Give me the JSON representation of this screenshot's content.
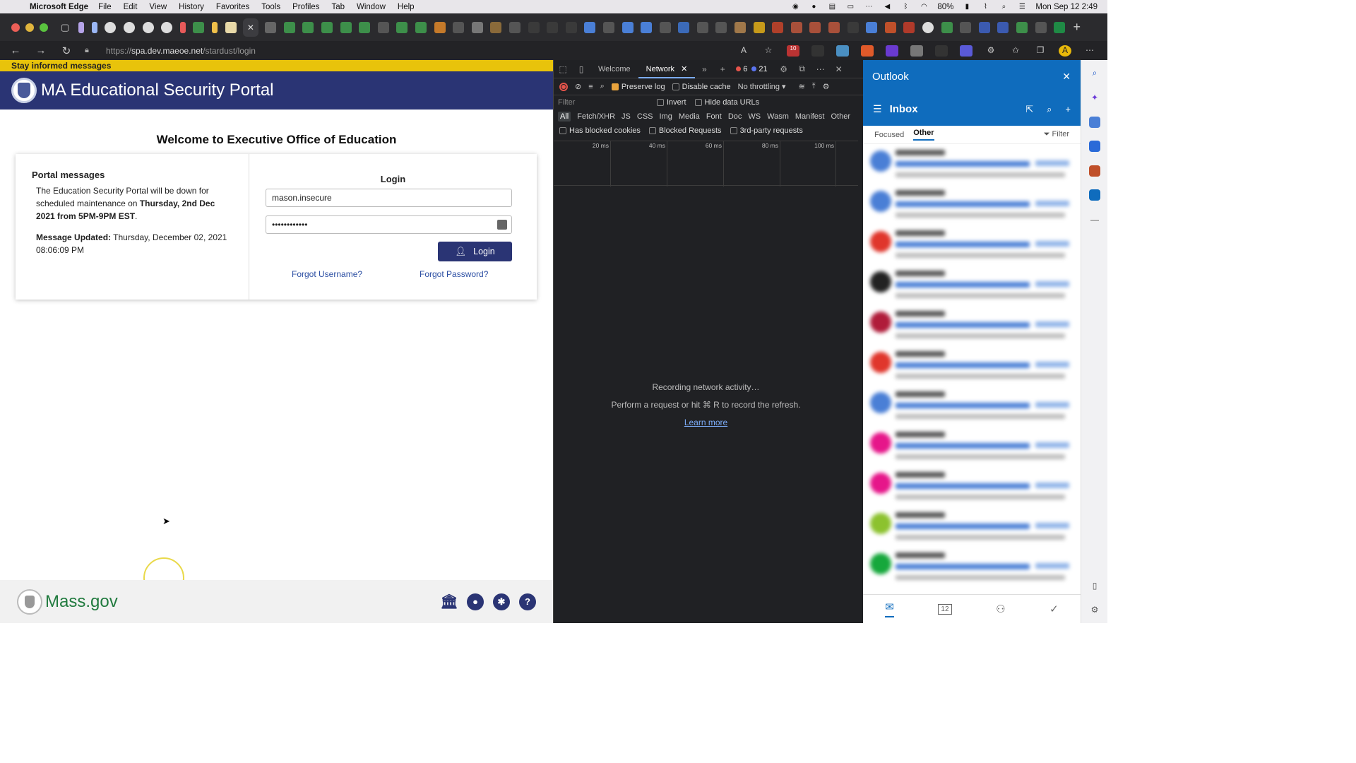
{
  "menubar": {
    "app": "Microsoft Edge",
    "items": [
      "File",
      "Edit",
      "View",
      "History",
      "Favorites",
      "Tools",
      "Profiles",
      "Tab",
      "Window",
      "Help"
    ],
    "battery": "80%",
    "clock": "Mon Sep 12  2:49"
  },
  "browser": {
    "url_prefix": "https://",
    "url_host": "spa.dev.maeoe.net",
    "url_path": "/stardust/login"
  },
  "page": {
    "banner": "Stay informed messages",
    "title": "MA Educational Security Portal",
    "welcome": "Welcome to Executive Office of Education",
    "messages": {
      "heading": "Portal messages",
      "body_start": "The Education Security Portal will be down for scheduled maintenance on ",
      "body_bold": "Thursday, 2nd Dec 2021 from 5PM-9PM EST",
      "body_end": ".",
      "updated_label": "Message Updated:",
      "updated_value": " Thursday, December 02, 2021 08:06:09 PM"
    },
    "login": {
      "heading": "Login",
      "username": "mason.insecure",
      "password_mask": "••••••••••••",
      "button": "Login",
      "forgot_username": "Forgot Username?",
      "forgot_password": "Forgot Password?"
    },
    "footer": {
      "brand": "Mass.gov"
    }
  },
  "devtools": {
    "tabs": [
      "Welcome",
      "Network"
    ],
    "errors": "6",
    "messages": "21",
    "preserve_log": "Preserve log",
    "disable_cache": "Disable cache",
    "throttling": "No throttling",
    "filter_placeholder": "Filter",
    "invert": "Invert",
    "hide_data_urls": "Hide data URLs",
    "types": [
      "All",
      "Fetch/XHR",
      "JS",
      "CSS",
      "Img",
      "Media",
      "Font",
      "Doc",
      "WS",
      "Wasm",
      "Manifest",
      "Other"
    ],
    "has_blocked_cookies": "Has blocked cookies",
    "blocked_requests": "Blocked Requests",
    "third_party": "3rd-party requests",
    "ticks": [
      "20 ms",
      "40 ms",
      "60 ms",
      "80 ms",
      "100 ms"
    ],
    "empty_line1": "Recording network activity…",
    "empty_line2": "Perform a request or hit ⌘ R to record the refresh.",
    "learn_more": "Learn more"
  },
  "outlook": {
    "title": "Outlook",
    "folder": "Inbox",
    "tabs": [
      "Focused",
      "Other"
    ],
    "filter": "Filter",
    "calendar_day": "12",
    "avatar_colors": [
      "#4a7fd6",
      "#4a7fd6",
      "#e0362c",
      "#222222",
      "#b01c3a",
      "#e0362c",
      "#4a7fd6",
      "#e6168a",
      "#e6168a",
      "#8cc22e",
      "#16a83c"
    ]
  }
}
